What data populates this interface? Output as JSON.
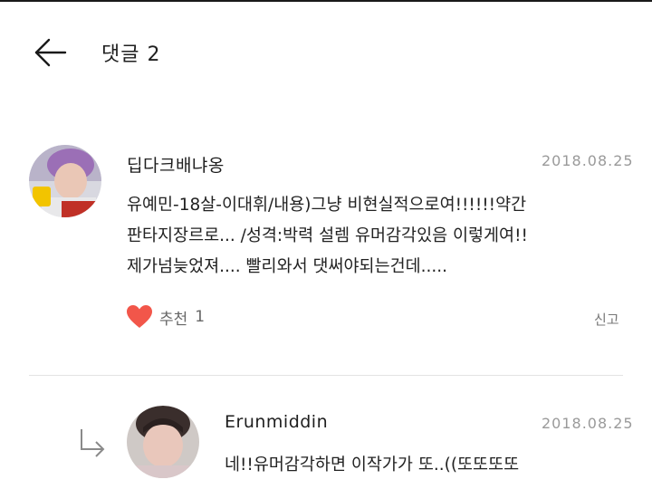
{
  "header": {
    "title": "댓글",
    "count": "2"
  },
  "comments": [
    {
      "author": "딥다크배냐옹",
      "date": "2018.08.25",
      "lines": [
        "유예민-18살-이대휘/내용)그냥 비현실적으로여!!!!!!약간",
        "판타지장르로... /성격:박력 설렘 유머감각있음 이렇게여!!",
        "제가넘늦었져.... 빨리와서 댓써야되는건데....."
      ],
      "like_label": "추천",
      "like_count": "1",
      "report_label": "신고"
    },
    {
      "author": "Erunmiddin",
      "date": "2018.08.25",
      "lines": [
        "네!!유머감각하면 이작가가 또..((또또또또"
      ]
    }
  ],
  "colors": {
    "like_heart": "#f2564a",
    "date_text": "#9a9a9a",
    "divider": "#e3e3e3"
  },
  "icons": {
    "back": "left-arrow-icon",
    "like": "heart-icon",
    "reply": "reply-arrow-icon"
  }
}
